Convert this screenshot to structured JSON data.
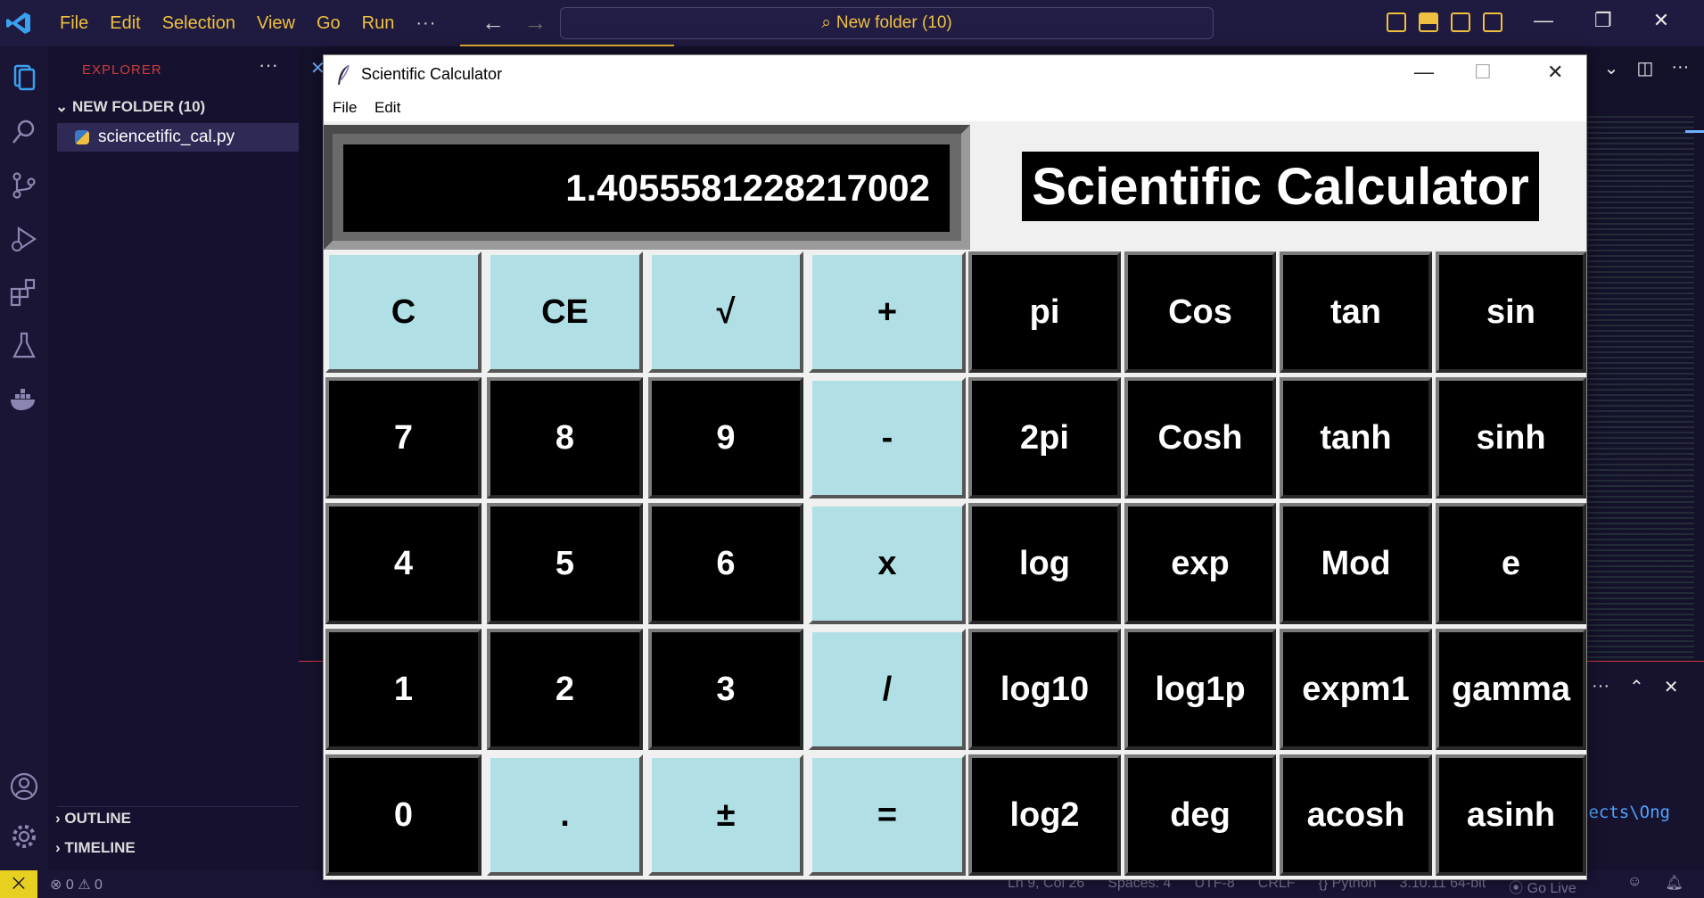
{
  "vscode": {
    "menu": [
      "File",
      "Edit",
      "Selection",
      "View",
      "Go",
      "Run",
      "···"
    ],
    "nav_back": "←",
    "nav_forward": "→",
    "search_icon_glyph": "⌕",
    "command_center": "New folder (10)",
    "sidebar": {
      "title": "EXPLORER",
      "dots": "···",
      "folder": "NEW FOLDER (10)",
      "file": "sciencetific_cal.py",
      "outline": "OUTLINE",
      "timeline": "TIMELINE"
    },
    "terminal_text": "jects\\Ong",
    "status": {
      "remote": "⨉",
      "problems": "⊗ 0 ⚠ 0",
      "items": [
        "Ln 9, Col 26",
        "Spaces: 4",
        "UTF-8",
        "CRLF",
        "{} Python",
        "3.10.11 64-bit",
        "⦿ Go Live"
      ]
    },
    "accent": "#f0c040"
  },
  "calculator": {
    "window_title": "Scientific Calculator",
    "menu": [
      "File",
      "Edit"
    ],
    "display_value": "1.4055581228217002",
    "heading": "Scientific Calculator",
    "keys_basic": [
      [
        "C",
        "CE",
        "√",
        "+"
      ],
      [
        "7",
        "8",
        "9",
        "-"
      ],
      [
        "4",
        "5",
        "6",
        "x"
      ],
      [
        "1",
        "2",
        "3",
        "/"
      ],
      [
        "0",
        ".",
        "±",
        "="
      ]
    ],
    "keys_scientific": [
      [
        "pi",
        "Cos",
        "tan",
        "sin"
      ],
      [
        "2pi",
        "Cosh",
        "tanh",
        "sinh"
      ],
      [
        "log",
        "exp",
        "Mod",
        "e"
      ],
      [
        "log10",
        "log1p",
        "expm1",
        "gamma"
      ],
      [
        "log2",
        "deg",
        "acosh",
        "asinh"
      ]
    ],
    "colors": {
      "light_key": "#b0e0e6",
      "dark_key": "#000000"
    }
  }
}
